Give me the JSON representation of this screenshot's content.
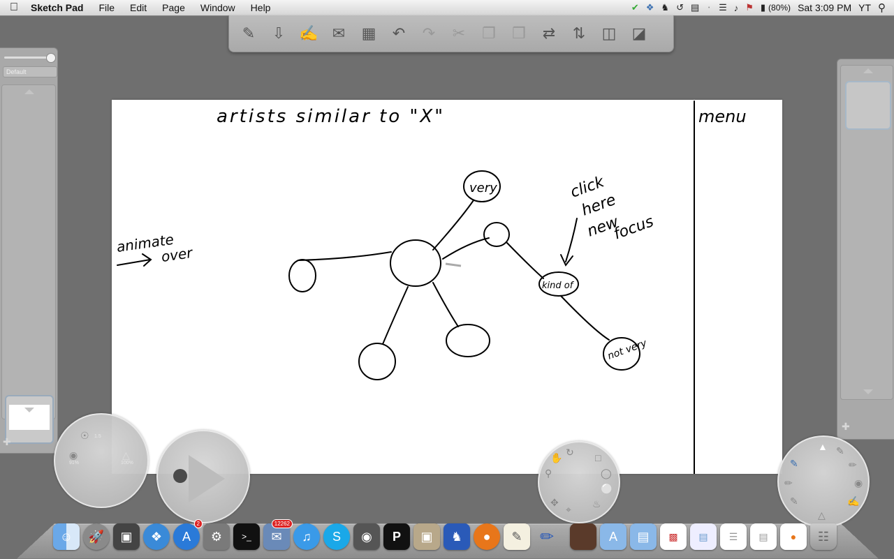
{
  "menubar": {
    "app": "Sketch Pad",
    "menus": [
      "File",
      "Edit",
      "Page",
      "Window",
      "Help"
    ],
    "battery": "(80%)",
    "clock": "Sat 3:09 PM",
    "user": "YT"
  },
  "toolbar": {
    "icons": [
      "new-page-icon",
      "import-icon",
      "edit-page-icon",
      "email-icon",
      "photo-icon",
      "undo-icon",
      "redo-icon",
      "cut-icon",
      "copy-icon",
      "paste-icon",
      "flip-horizontal-icon",
      "flip-vertical-icon",
      "previous-page-icon",
      "next-page-icon"
    ]
  },
  "left_panel": {
    "preset": "Default"
  },
  "canvas": {
    "header_text": "artists similar to \"X\"",
    "menu_text": "menu",
    "left_note_1": "animate",
    "left_note_2": "over",
    "bubble_top": "very",
    "bubble_kindof": "kind of",
    "bubble_notvery": "not very",
    "note_1": "click",
    "note_2": "here",
    "note_3": "new",
    "note_4": "focus"
  },
  "brush_wheel": {
    "size_value": "1.5",
    "opacity_value": "91%",
    "flow_value": "100%"
  },
  "dock": {
    "app_store_badge": "2",
    "mail_badge": "12262",
    "apps": [
      "Finder",
      "Launchpad",
      "Photo Booth",
      "Safari",
      "App Store",
      "System Preferences",
      "Terminal",
      "Mail",
      "iTunes",
      "Skype",
      "FaceTime",
      "Prezi",
      "Preview",
      "Cyberduck",
      "Firefox",
      "TextEdit",
      "Sketch Pad"
    ]
  },
  "colors": {
    "desktop": "#6f6f6f",
    "panel": "#a9a9a9",
    "canvas": "#ffffff",
    "ink": "#000000"
  }
}
